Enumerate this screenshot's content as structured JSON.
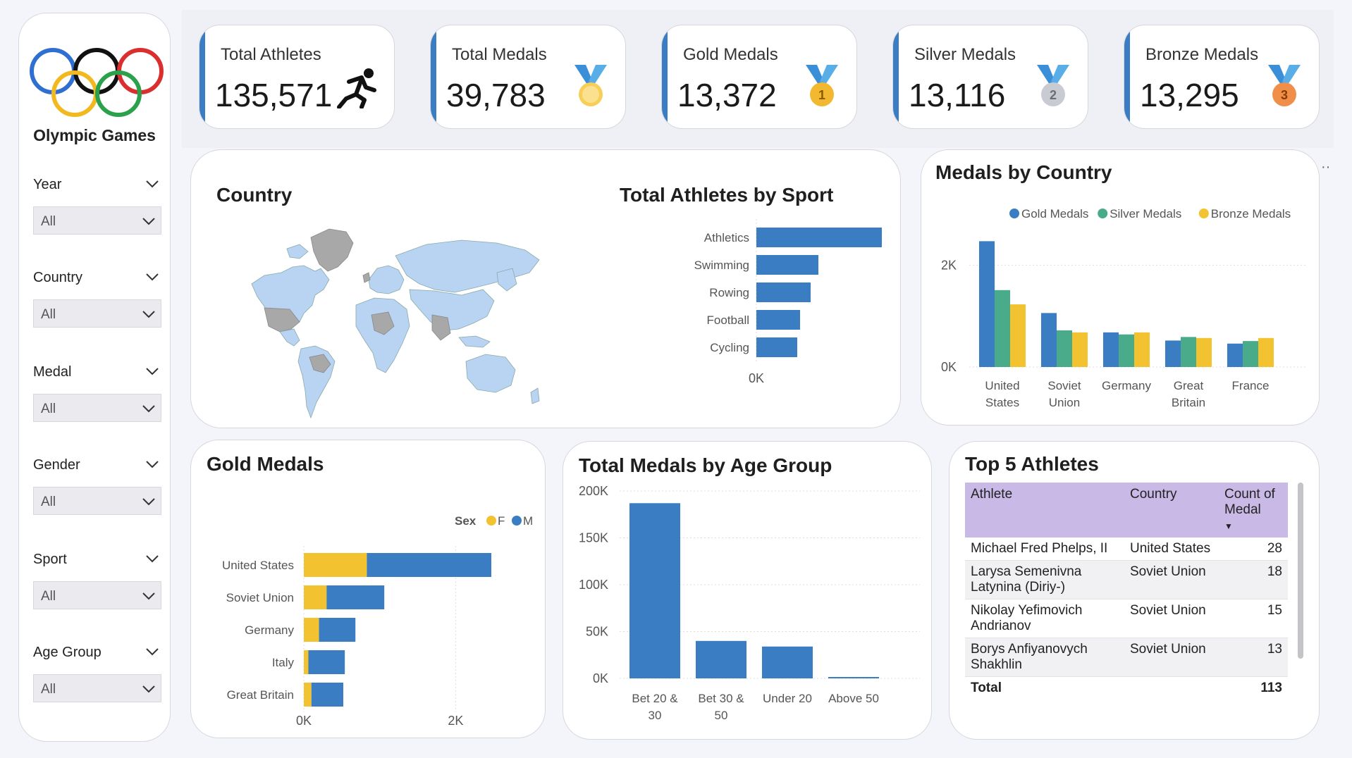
{
  "sidebar": {
    "brand": "Olympic Games",
    "slicers": [
      {
        "label": "Year",
        "value": "All"
      },
      {
        "label": "Country",
        "value": "All"
      },
      {
        "label": "Medal",
        "value": "All"
      },
      {
        "label": "Gender",
        "value": "All"
      },
      {
        "label": "Sport",
        "value": "All"
      },
      {
        "label": "Age Group",
        "value": "All"
      }
    ]
  },
  "kpis": [
    {
      "label": "Total Athletes",
      "value": "135,571",
      "icon": "runner-icon"
    },
    {
      "label": "Total Medals",
      "value": "39,783",
      "icon": "medal-icon"
    },
    {
      "label": "Gold Medals",
      "value": "13,372",
      "icon": "gold-medal-icon",
      "badge": "1"
    },
    {
      "label": "Silver Medals",
      "value": "13,116",
      "icon": "silver-medal-icon",
      "badge": "2"
    },
    {
      "label": "Bronze Medals",
      "value": "13,295",
      "icon": "bronze-medal-icon",
      "badge": "3"
    }
  ],
  "map": {
    "title": "Country"
  },
  "colors": {
    "blue": "#3a7dc2",
    "green": "#4aab8a",
    "yellow": "#f2c230",
    "header": "#c8b9e6"
  },
  "chart_data": [
    {
      "id": "athletes_by_sport",
      "type": "bar",
      "orientation": "horizontal",
      "title": "Total Athletes by Sport",
      "categories": [
        "Athletics",
        "Swimming",
        "Rowing",
        "Football",
        "Cycling"
      ],
      "values": [
        22000,
        8800,
        7700,
        6200,
        5800
      ],
      "ticks": [
        {
          "v": 0,
          "label": "0K"
        },
        {
          "v": 20000,
          "label": "20K"
        }
      ],
      "xlim": [
        0,
        24000
      ],
      "grid": true
    },
    {
      "id": "medals_by_country",
      "type": "bar",
      "title": "Medals by Country",
      "categories": [
        "United States",
        "Soviet Union",
        "Germany",
        "Great Britain",
        "France"
      ],
      "category_lines": [
        [
          "United",
          "States"
        ],
        [
          "Soviet",
          "Union"
        ],
        [
          "Germany"
        ],
        [
          "Great",
          "Britain"
        ],
        [
          "France"
        ]
      ],
      "series": [
        {
          "name": "Gold Medals",
          "values": [
            2470,
            1060,
            680,
            520,
            460
          ],
          "color": "#3a7dc2"
        },
        {
          "name": "Silver Medals",
          "values": [
            1510,
            720,
            640,
            590,
            510
          ],
          "color": "#4aab8a"
        },
        {
          "name": "Bronze Medals",
          "values": [
            1230,
            680,
            680,
            570,
            570
          ],
          "color": "#f2c230"
        }
      ],
      "ticks": [
        {
          "v": 0,
          "label": "0K"
        },
        {
          "v": 2000,
          "label": "2K"
        }
      ],
      "ylim": [
        0,
        2600
      ],
      "legend": "top-right",
      "grid": true
    },
    {
      "id": "gold_medals",
      "type": "bar",
      "orientation": "horizontal",
      "stacked": true,
      "title": "Gold Medals",
      "legend_title": "Sex",
      "categories": [
        "United States",
        "Soviet Union",
        "Germany",
        "Italy",
        "Great Britain"
      ],
      "series": [
        {
          "name": "F",
          "values": [
            830,
            300,
            200,
            60,
            100
          ],
          "color": "#f2c230"
        },
        {
          "name": "M",
          "values": [
            1640,
            760,
            480,
            480,
            420
          ],
          "color": "#3a7dc2"
        }
      ],
      "ticks": [
        {
          "v": 0,
          "label": "0K"
        },
        {
          "v": 2000,
          "label": "2K"
        }
      ],
      "xlim": [
        0,
        2600
      ],
      "legend": "top-right",
      "grid": true
    },
    {
      "id": "medals_by_age",
      "type": "bar",
      "title": "Total Medals by Age Group",
      "categories": [
        "Bet 20 & 30",
        "Bet 30 & 50",
        "Under 20",
        "Above 50"
      ],
      "category_lines": [
        [
          "Bet 20 &",
          "30"
        ],
        [
          "Bet 30 &",
          "50"
        ],
        [
          "Under 20"
        ],
        [
          "Above 50"
        ]
      ],
      "values": [
        187000,
        40000,
        34000,
        1500
      ],
      "ticks": [
        {
          "v": 0,
          "label": "0K"
        },
        {
          "v": 50000,
          "label": "50K"
        },
        {
          "v": 100000,
          "label": "100K"
        },
        {
          "v": 150000,
          "label": "150K"
        },
        {
          "v": 200000,
          "label": "200K"
        }
      ],
      "ylim": [
        0,
        200000
      ],
      "grid": true
    }
  ],
  "top_athletes": {
    "title": "Top 5 Athletes",
    "headers": [
      "Athlete",
      "Country",
      "Count of Medal"
    ],
    "rows": [
      {
        "athlete": "Michael Fred Phelps, II",
        "country": "United States",
        "count": "28"
      },
      {
        "athlete": "Larysa Semenivna Latynina (Diriy-)",
        "country": "Soviet Union",
        "count": "18"
      },
      {
        "athlete": "Nikolay Yefimovich Andrianov",
        "country": "Soviet Union",
        "count": "15"
      },
      {
        "athlete": "Borys Anfiyanovych Shakhlin",
        "country": "Soviet Union",
        "count": "13"
      }
    ],
    "total_label": "Total",
    "total_value": "113"
  }
}
